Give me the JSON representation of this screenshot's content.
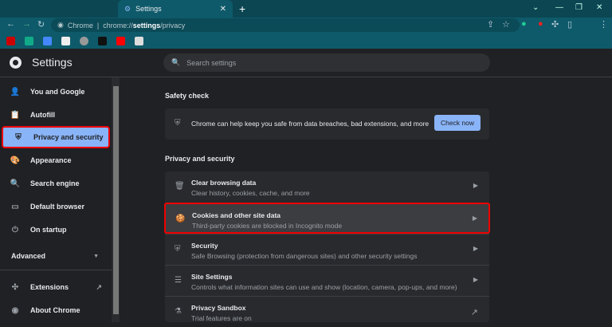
{
  "browser": {
    "tab_title": "Settings",
    "url_scheme": "Chrome",
    "url_prefix": "chrome://",
    "url_host": "settings",
    "url_path": "/privacy"
  },
  "settings": {
    "title": "Settings",
    "search_placeholder": "Search settings"
  },
  "sidebar": {
    "items": [
      {
        "label": "You and Google",
        "icon": "person-icon",
        "glyph": "👤"
      },
      {
        "label": "Autofill",
        "icon": "clipboard-icon",
        "glyph": "📋"
      },
      {
        "label": "Privacy and security",
        "icon": "shield-icon",
        "glyph": "⛨"
      },
      {
        "label": "Appearance",
        "icon": "palette-icon",
        "glyph": "🎨"
      },
      {
        "label": "Search engine",
        "icon": "search-icon",
        "glyph": "🔍"
      },
      {
        "label": "Default browser",
        "icon": "browser-icon",
        "glyph": "▭"
      },
      {
        "label": "On startup",
        "icon": "power-icon",
        "glyph": "⏻"
      }
    ],
    "advanced": "Advanced",
    "extensions": "Extensions",
    "about": "About Chrome"
  },
  "safety": {
    "heading": "Safety check",
    "text": "Chrome can help keep you safe from data breaches, bad extensions, and more",
    "button": "Check now"
  },
  "privacy": {
    "heading": "Privacy and security",
    "rows": [
      {
        "title": "Clear browsing data",
        "sub": "Clear history, cookies, cache, and more",
        "icon": "trash-icon",
        "glyph": "🗑"
      },
      {
        "title": "Cookies and other site data",
        "sub": "Third-party cookies are blocked in Incognito mode",
        "icon": "cookie-icon",
        "glyph": "🍪"
      },
      {
        "title": "Security",
        "sub": "Safe Browsing (protection from dangerous sites) and other security settings",
        "icon": "shield-icon",
        "glyph": "⛨"
      },
      {
        "title": "Site Settings",
        "sub": "Controls what information sites can use and show (location, camera, pop-ups, and more)",
        "icon": "sliders-icon",
        "glyph": "☰"
      },
      {
        "title": "Privacy Sandbox",
        "sub": "Trial features are on",
        "icon": "flask-icon",
        "glyph": "⚗"
      }
    ]
  },
  "colors": {
    "accent": "#8ab4f8",
    "highlight": "#e00000",
    "frame": "#0e5a6a"
  }
}
